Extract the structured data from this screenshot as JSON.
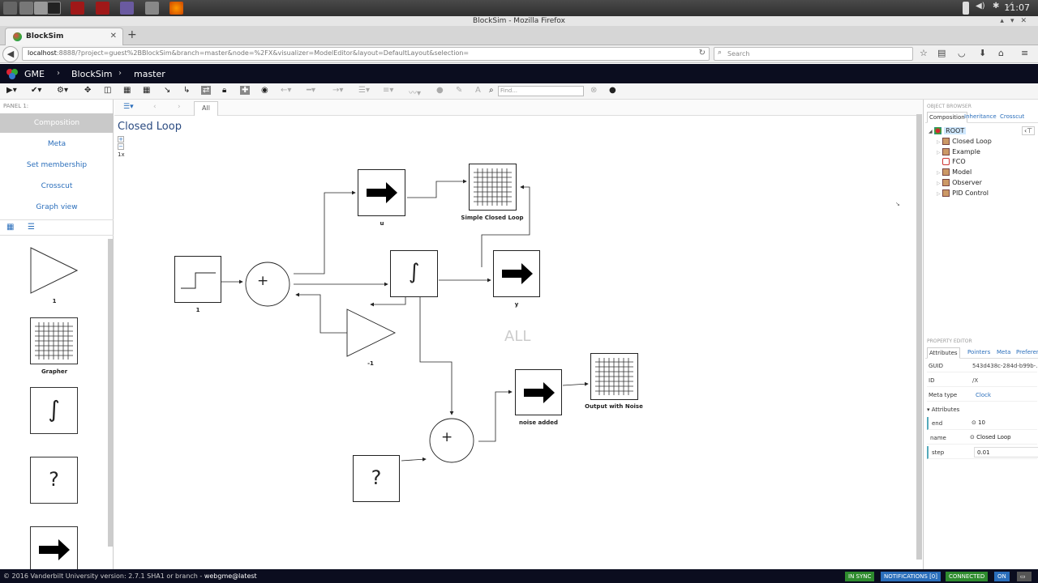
{
  "os": {
    "clock": "11:07"
  },
  "browser": {
    "window_title": "BlockSim - Mozilla Firefox",
    "tab_title": "BlockSim",
    "url_host": "localhost",
    "url_rest": ":8888/?project=guest%2BBlockSim&branch=master&node=%2FX&visualizer=ModelEditor&layout=DefaultLayout&selection=",
    "search_placeholder": "Search"
  },
  "gme": {
    "app": "GME",
    "project": "BlockSim",
    "branch": "master"
  },
  "toolbar": {
    "find_placeholder": "Find..."
  },
  "left_panel": {
    "label": "PANEL 1:",
    "nav": [
      "Composition",
      "Meta",
      "Set membership",
      "Crosscut",
      "Graph view"
    ],
    "parts": [
      {
        "label": "1"
      },
      {
        "label": "Grapher"
      },
      {
        "label": ""
      },
      {
        "label": ""
      },
      {
        "label": ""
      }
    ]
  },
  "canvas": {
    "tab": "All",
    "title": "Closed Loop",
    "zoom": "1x",
    "watermark": "ALL",
    "blocks": {
      "step": "1",
      "gain": "-1",
      "u": "u",
      "y": "y",
      "scl": "Simple Closed Loop",
      "noise": "noise added",
      "own": "Output with Noise",
      "sum": "+",
      "int": "∫",
      "unknown": "?"
    }
  },
  "object_browser": {
    "header": "OBJECT BROWSER",
    "tabs": [
      "Composition",
      "Inheritance",
      "Crosscut"
    ],
    "root": "ROOT",
    "items": [
      "Closed Loop",
      "Example",
      "FCO",
      "Model",
      "Observer",
      "PID Control"
    ]
  },
  "property_editor": {
    "header": "PROPERTY EDITOR",
    "tabs": [
      "Attributes",
      "Pointers",
      "Meta",
      "Preferences"
    ],
    "guid_label": "GUID",
    "guid": "543d438c-284d-b99b-...",
    "id_label": "ID",
    "id": "/X",
    "metatype_label": "Meta type",
    "metatype": "Clock",
    "attr_section": "Attributes",
    "attrs": [
      {
        "k": "end",
        "v": "10"
      },
      {
        "k": "name",
        "v": "Closed Loop"
      },
      {
        "k": "step",
        "v": "0.01"
      }
    ]
  },
  "footer": {
    "copyright": "© 2016 Vanderbilt University",
    "version": "version: 2.7.1",
    "sha": "SHA1 or branch -",
    "webgme": "webgme@latest",
    "badges": [
      "IN SYNC",
      "NOTIFICATIONS [0]",
      "CONNECTED",
      "ON"
    ]
  }
}
